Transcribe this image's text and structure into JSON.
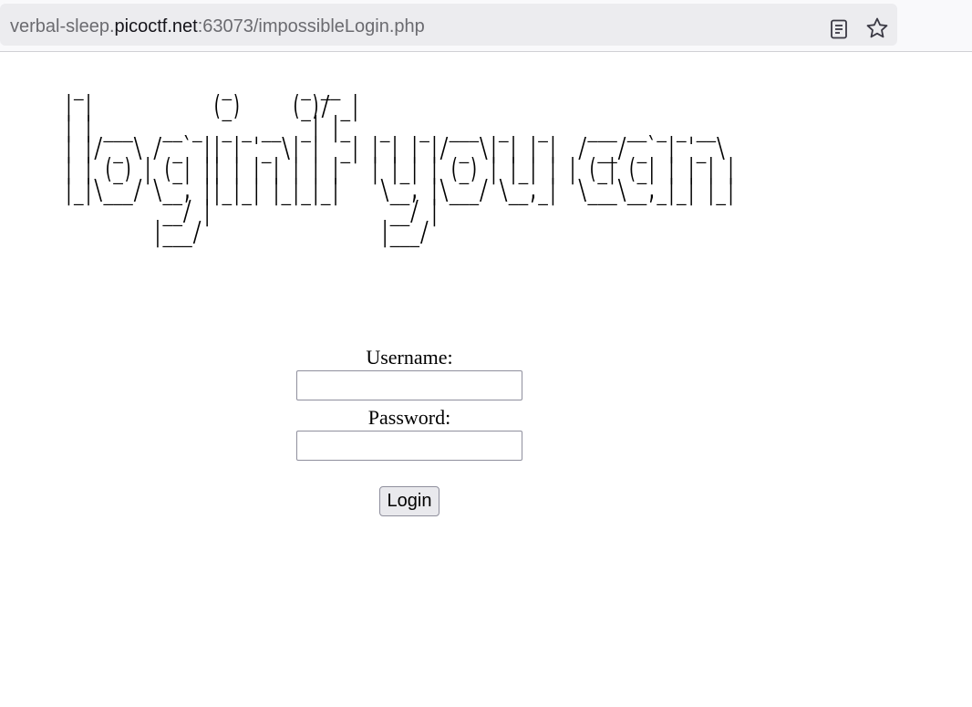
{
  "browser": {
    "url_prefix": "verbal-sleep.",
    "url_host": "picoctf.net",
    "url_suffix": ":63073/impossibleLogin.php",
    "icons": [
      "reader-view-icon",
      "bookmark-star-icon"
    ]
  },
  "page": {
    "banner_ascii": " _              _       _ __\n| |            (_)     (_)/ _|\n| | ___   __ _  _ _ __  _| |_   _   _  ___  _   _    ___ __ _ _ __\n| |/ _ \\ / _` || | '_ \\| |  _| | | | |/ _ \\| | | |  / __/ _` | '_ \\\n| | (_) | (_| || | | | | | |   | |_| | (_) | |_| | | (_| (_| | | | |\n|_|\\___/ \\__, ||_|_| |_|_|_|    \\__, |\\___/ \\__,_|  \\___\\__,_|_| |_|\n          __/ |                  __/ |\n         |___/                  |___/",
    "form": {
      "username_label": "Username:",
      "username_value": "",
      "password_label": "Password:",
      "password_value": "",
      "login_label": "Login"
    }
  }
}
